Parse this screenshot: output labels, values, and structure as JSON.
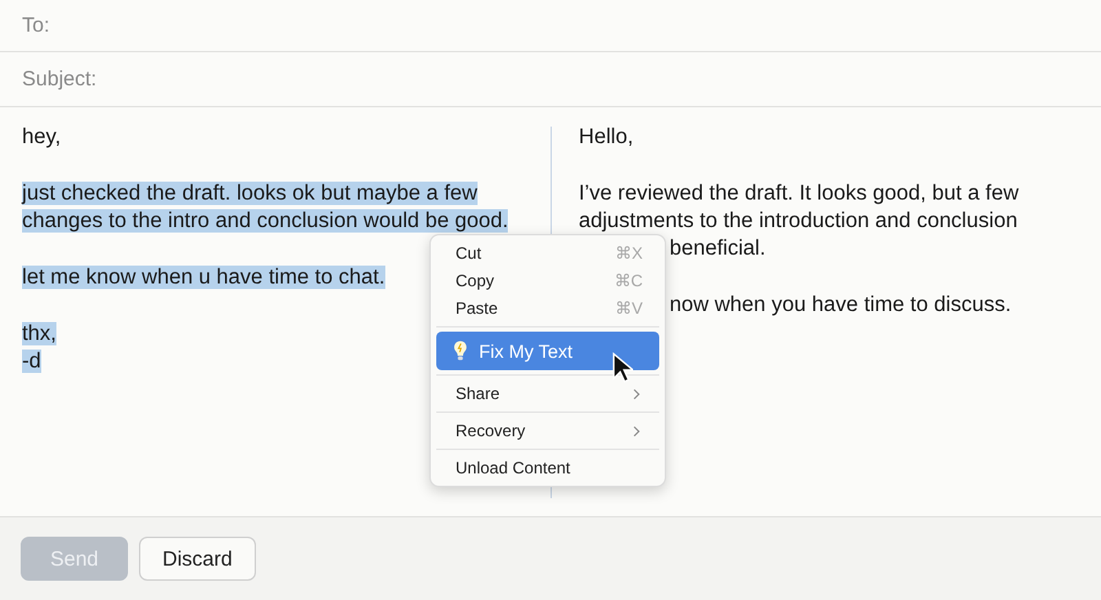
{
  "fields": [
    {
      "label": "To:"
    },
    {
      "label": "Subject:"
    }
  ],
  "draft": {
    "paragraphs": [
      {
        "selected": false,
        "lines": [
          "hey,"
        ]
      },
      {
        "selected": true,
        "lines": [
          "just checked the draft. looks ok but maybe a few",
          "changes to the intro and conclusion would be good."
        ]
      },
      {
        "selected": true,
        "lines": [
          "let me know when u have time to chat."
        ]
      },
      {
        "selected": true,
        "lines": [
          "thx,",
          "-d"
        ]
      }
    ]
  },
  "rewrite": {
    "paragraphs": [
      {
        "lines": [
          {
            "text": "Hello,",
            "covered": false
          }
        ]
      },
      {
        "lines": [
          {
            "text": "I’ve reviewed the draft. It looks good, but a few",
            "covered": false
          },
          {
            "text": "adjustments to the introduction and conclusion",
            "covered": false
          },
          {
            "text": "beneficial.",
            "covered": true
          }
        ]
      },
      {
        "lines": [
          {
            "text": "now when you have time to discuss.",
            "covered": true
          }
        ]
      }
    ]
  },
  "context_menu": {
    "groups": [
      [
        {
          "kind": "shortcut",
          "label": "Cut",
          "shortcut": "⌘X",
          "selected": false
        },
        {
          "kind": "shortcut",
          "label": "Copy",
          "shortcut": "⌘C",
          "selected": false
        },
        {
          "kind": "shortcut",
          "label": "Paste",
          "shortcut": "⌘V",
          "selected": false
        }
      ],
      [
        {
          "kind": "assist",
          "label": "Fix My Text",
          "selected": true
        }
      ],
      [
        {
          "kind": "submenu",
          "label": "Share",
          "selected": false
        }
      ],
      [
        {
          "kind": "submenu",
          "label": "Recovery",
          "selected": false
        }
      ],
      [
        {
          "kind": "plain",
          "label": "Unload Content",
          "selected": false
        }
      ]
    ]
  },
  "buttons": [
    {
      "label": "Send",
      "disabled": true
    },
    {
      "label": "Discard",
      "disabled": false
    }
  ]
}
